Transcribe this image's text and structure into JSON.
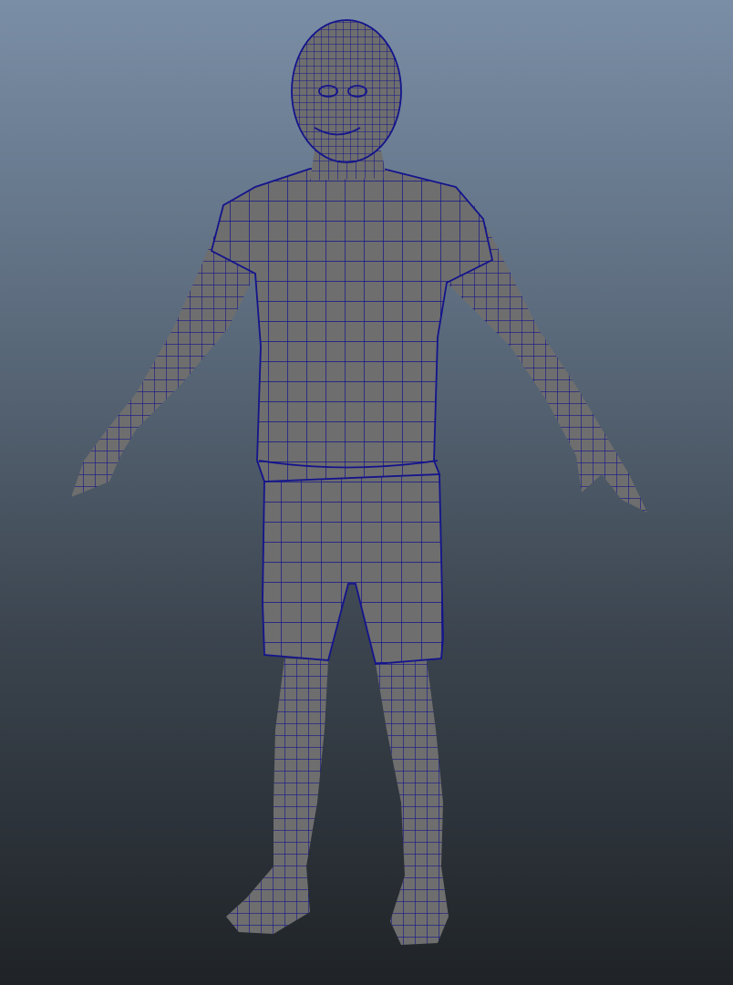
{
  "viewport": {
    "background_top": "#7a8ea6",
    "background_bottom": "#1f2327"
  },
  "model": {
    "surface_color": "#6e6e6e",
    "surface_shadow": "#4a4a4a",
    "wireframe_color": "#14148c",
    "display_mode": "shaded-with-wireframe",
    "pose": "A-pose"
  }
}
